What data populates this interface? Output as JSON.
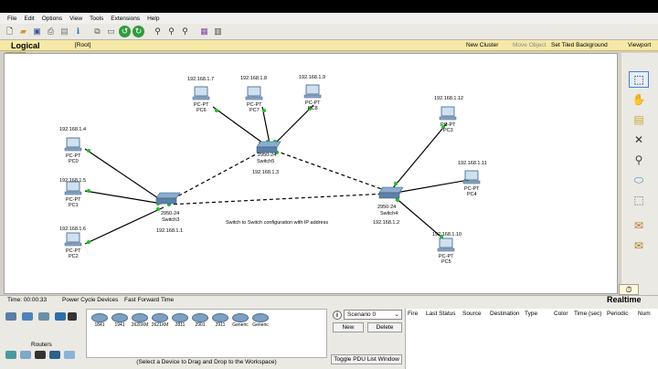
{
  "menu": [
    "File",
    "Edit",
    "Options",
    "View",
    "Tools",
    "Extensions",
    "Help"
  ],
  "toolbar_icons": [
    "new-file-icon",
    "open-icon",
    "save-icon",
    "print-icon",
    "wizard-icon",
    "network-info-icon",
    "copy-icon",
    "paste-icon",
    "undo-icon",
    "redo-icon",
    "zoom-in-icon",
    "zoom-reset-icon",
    "zoom-out-icon",
    "palette-icon",
    "custom-device-icon"
  ],
  "workspace": {
    "logical": "Logical",
    "root": "[Root]",
    "new_cluster": "New Cluster",
    "move_object": "Move Object",
    "tiled_background": "Set Tiled Background",
    "viewport": "Viewport"
  },
  "topology": {
    "caption": "Switch to Switch configuration with IP address",
    "switches": [
      {
        "name": "Switch3",
        "model": "2950-24",
        "ip": "192.168.1.1"
      },
      {
        "name": "Switch5",
        "model": "2950-24",
        "ip": "192.168.1.3"
      },
      {
        "name": "Switch4",
        "model": "2950-24",
        "ip": "192.168.1.2"
      }
    ],
    "pcs": [
      {
        "name": "PC0",
        "type": "PC-PT",
        "ip": "192.168.1.4"
      },
      {
        "name": "PC1",
        "type": "PC-PT",
        "ip": "192.168.1.5"
      },
      {
        "name": "PC2",
        "type": "PC-PT",
        "ip": "192.168.1.6"
      },
      {
        "name": "PC6",
        "type": "PC-PT",
        "ip": "192.168.1.7"
      },
      {
        "name": "PC7",
        "type": "PC-PT",
        "ip": "192.168.1.8"
      },
      {
        "name": "PC8",
        "type": "PC-PT",
        "ip": "192.168.1.9"
      },
      {
        "name": "PC3",
        "type": "PC-PT",
        "ip": "192.168.1.12"
      },
      {
        "name": "PC4",
        "type": "PC-PT",
        "ip": "192.168.1.11"
      },
      {
        "name": "PC5",
        "type": "PC-PT",
        "ip": "192.168.1.10"
      }
    ]
  },
  "status": {
    "time": "Time: 00:00:33",
    "power_cycle": "Power Cycle Devices",
    "fast_forward": "Fast Forward Time",
    "realtime": "Realtime"
  },
  "device_panel": {
    "category": "Routers",
    "models": [
      "1841",
      "1941",
      "2620XM",
      "2621XM",
      "2811",
      "2901",
      "2911",
      "Generic",
      "Generic"
    ],
    "hint": "(Select a Device to Drag and Drop to the Workspace)"
  },
  "scenario": {
    "selected": "Scenario 0",
    "new": "New",
    "delete": "Delete",
    "toggle": "Toggle PDU List Window"
  },
  "pdu_columns": [
    "Fire",
    "Last Status",
    "Source",
    "Destination",
    "Type",
    "Color",
    "Time (sec)",
    "Periodic",
    "Num"
  ]
}
